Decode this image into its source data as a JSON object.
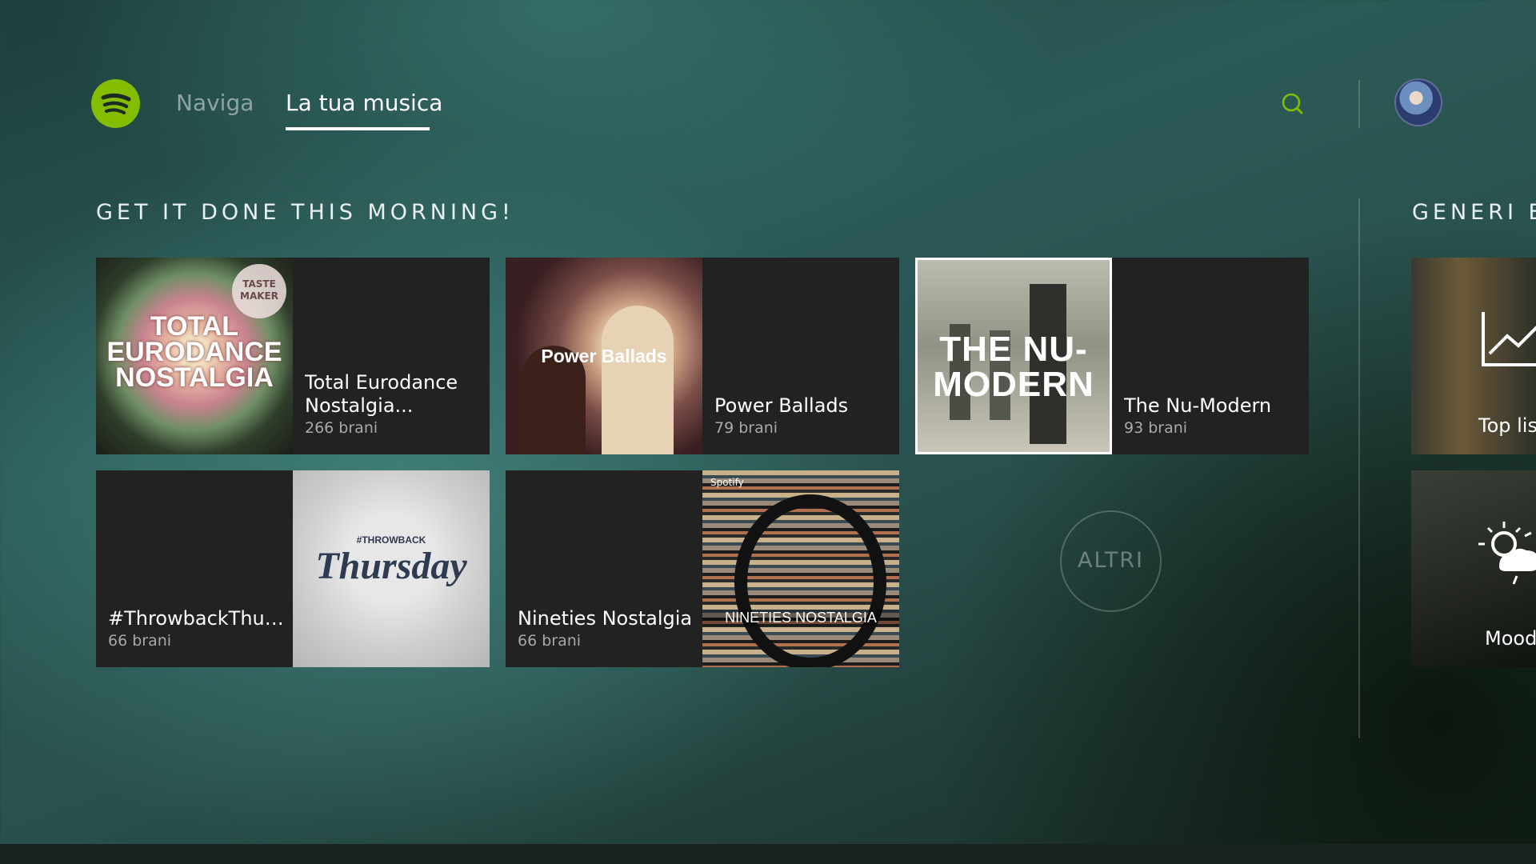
{
  "header": {
    "logo": "spotify-logo",
    "tabs": [
      {
        "label": "Naviga",
        "active": false
      },
      {
        "label": "La tua musica",
        "active": true
      }
    ],
    "search_icon": "search-icon",
    "avatar": "user-avatar"
  },
  "colors": {
    "accent": "#84bd00",
    "card_bg": "#222222",
    "muted_text": "#a7aaa9"
  },
  "section_main": {
    "title": "GET IT DONE THIS MORNING!",
    "playlists": [
      {
        "title": "Total Eurodance Nostalgia...",
        "count": "266 brani",
        "cover_text": "TOTAL EURODANCE NOSTALGIA",
        "badge": "TASTE MAKER"
      },
      {
        "title": "Power Ballads",
        "count": "79 brani",
        "cover_text": "Power Ballads"
      },
      {
        "title": "The Nu-Modern",
        "count": "93 brani",
        "cover_text": "THE NU-MODERN"
      },
      {
        "title": "#ThrowbackThur...",
        "count": "66 brani",
        "cover_text": "Thursday",
        "cover_subtext": "#THROWBACK"
      },
      {
        "title": "Nineties Nostalgia",
        "count": "66 brani",
        "cover_text": "NINETIES NOSTALGIA",
        "cover_brand": "Spotify"
      }
    ],
    "more_label": "ALTRI"
  },
  "section_genres": {
    "title": "GENERI E",
    "tiles": [
      {
        "label": "Top lis",
        "icon": "trend-chart-icon"
      },
      {
        "label": "Mood",
        "icon": "weather-sun-cloud-icon"
      }
    ]
  }
}
